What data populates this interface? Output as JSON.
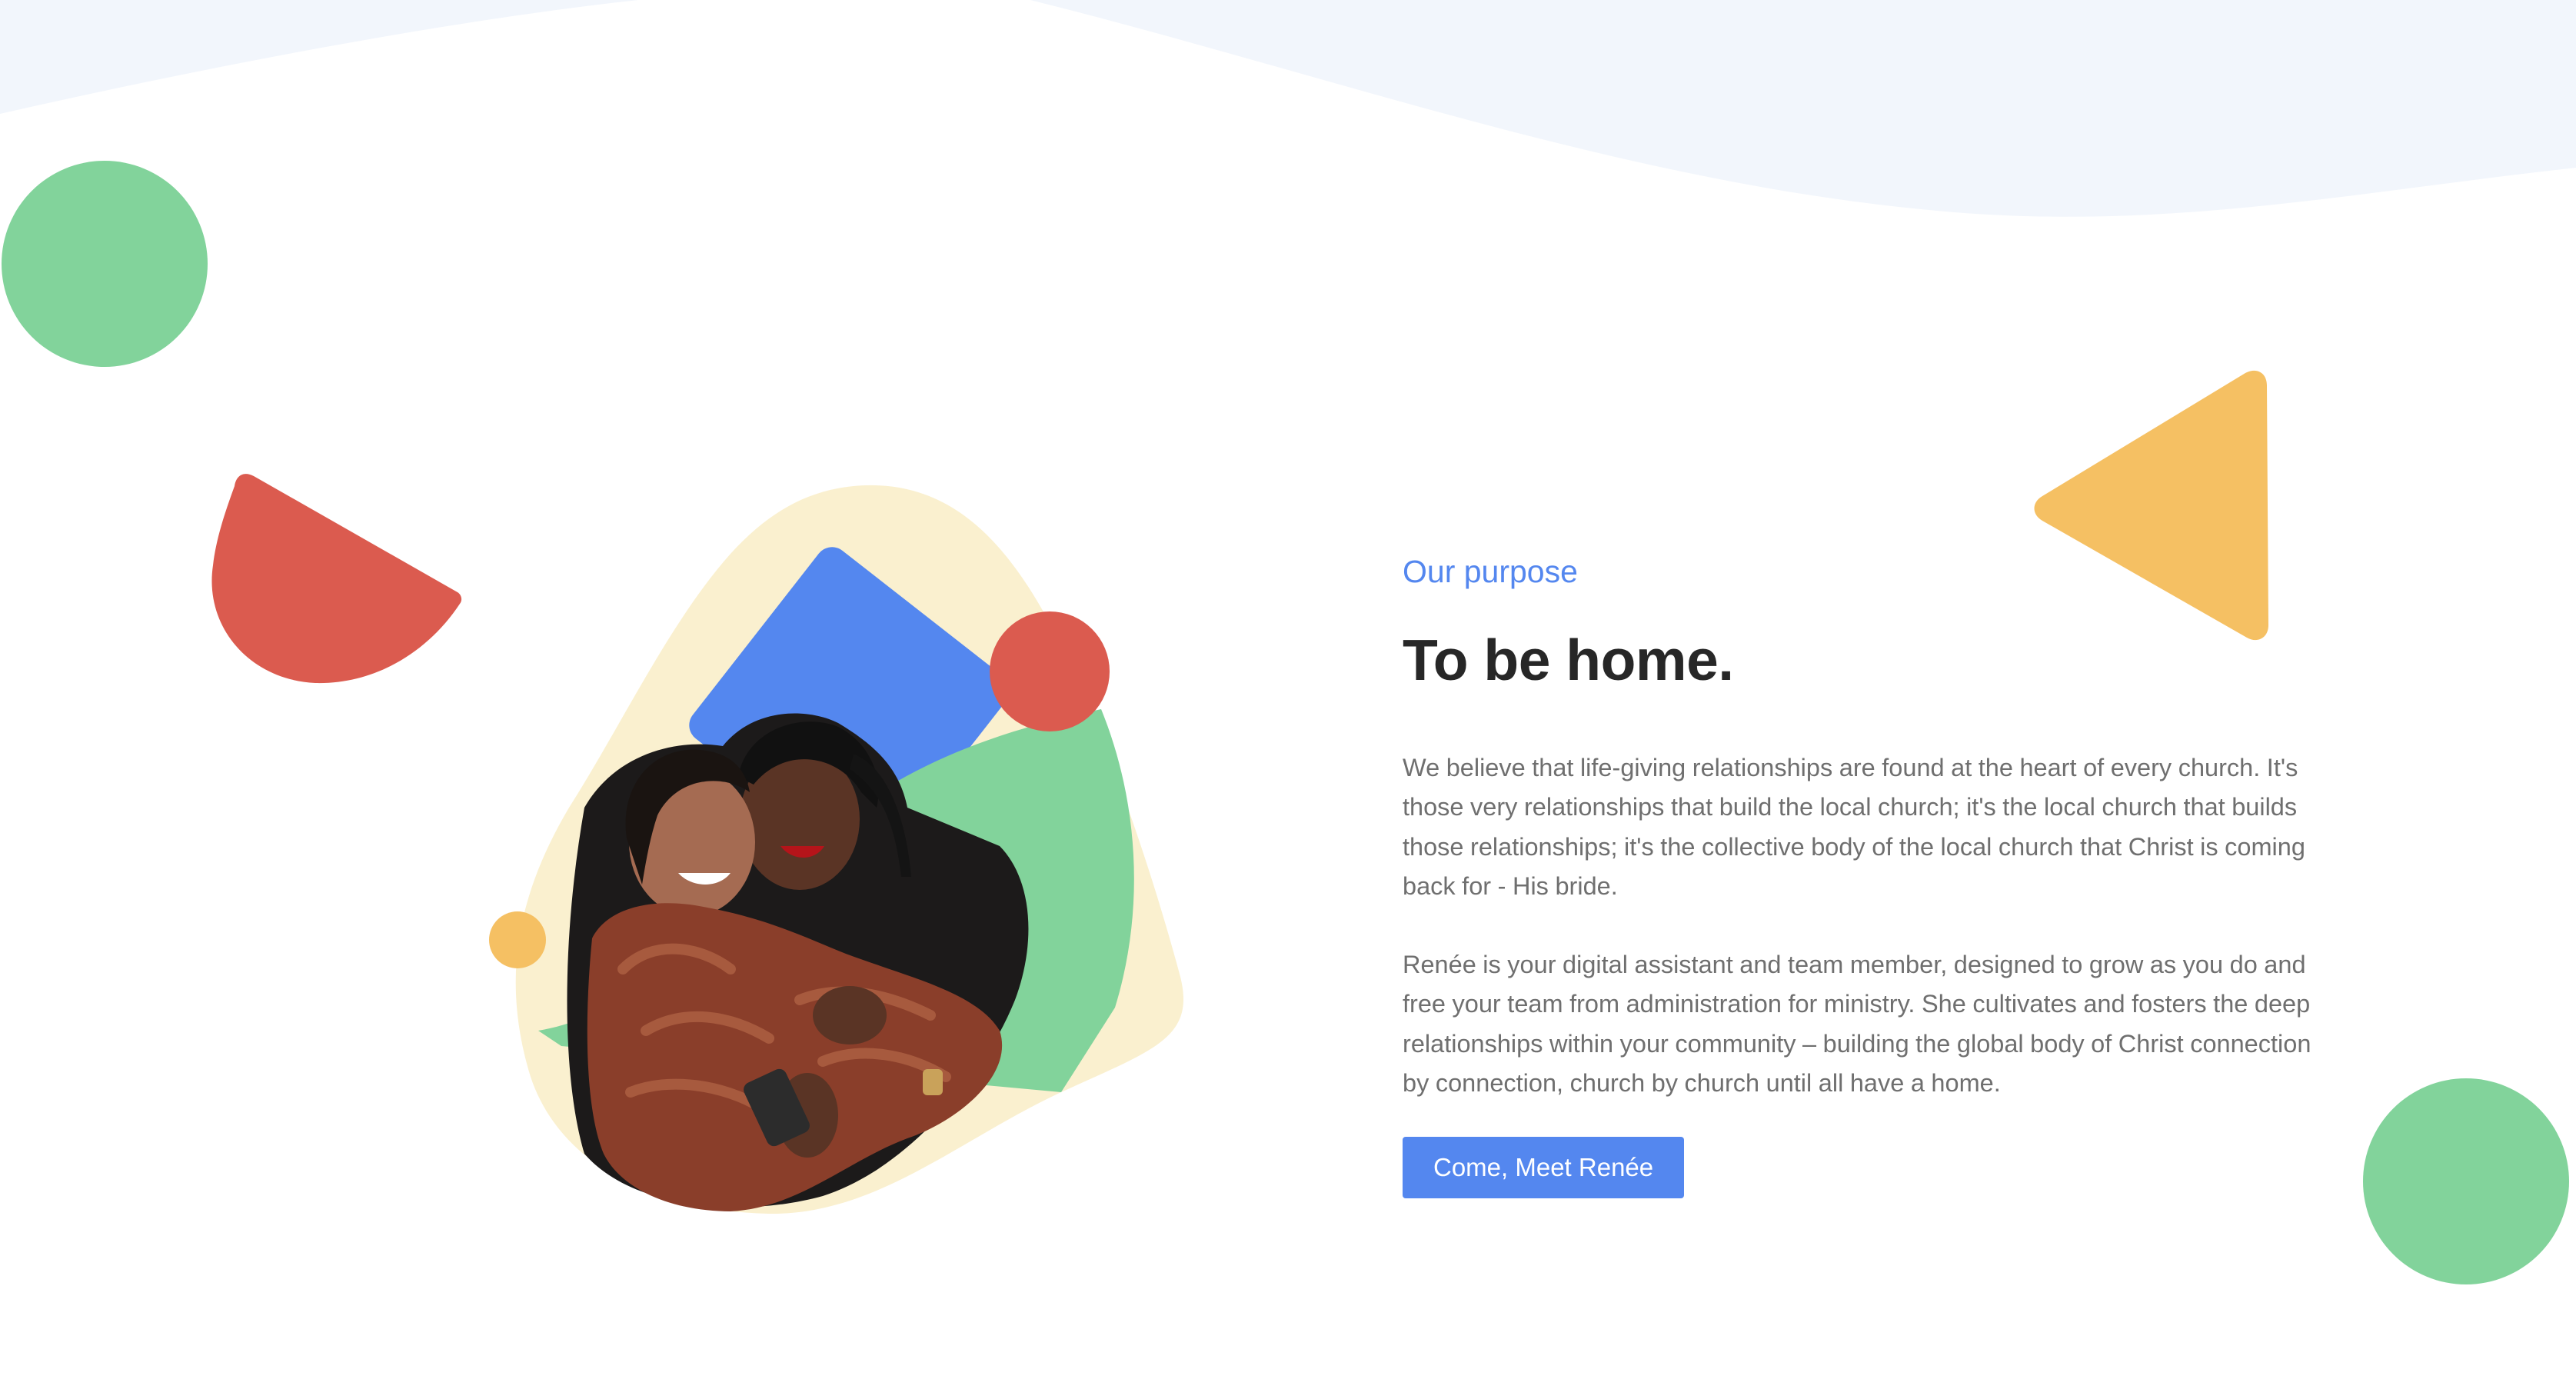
{
  "colors": {
    "accent_blue": "#5487ef",
    "green": "#82d39b",
    "red": "#db5b4f",
    "yellow": "#f5c063",
    "blob_cream": "#faf0cf",
    "wave_tint": "#f2f6fc",
    "heading_dark": "#272727",
    "body_gray": "#6f6f6f",
    "button_text": "#ffffff"
  },
  "section": {
    "eyebrow": "Our purpose",
    "title": "To be home.",
    "paragraphs": [
      "We believe that life-giving relationships are found at the heart of every church. It's those very relationships that build the local church; it's the local church that builds those relationships; it's the collective body of the local church that Christ is coming back for - His bride.",
      "Renée is your digital assistant and team member, designed to grow as you do and free your team from administration for ministry. She cultivates and fosters the deep relationships within your community – building the global body of Christ connection by connection, church by church until all have a home."
    ],
    "cta_label": "Come, Meet Renée"
  },
  "decorations": {
    "shapes": [
      "green-circle",
      "red-half-circle",
      "yellow-triangle",
      "green-circle"
    ],
    "hero_image": "photo-two-women-hugging"
  }
}
